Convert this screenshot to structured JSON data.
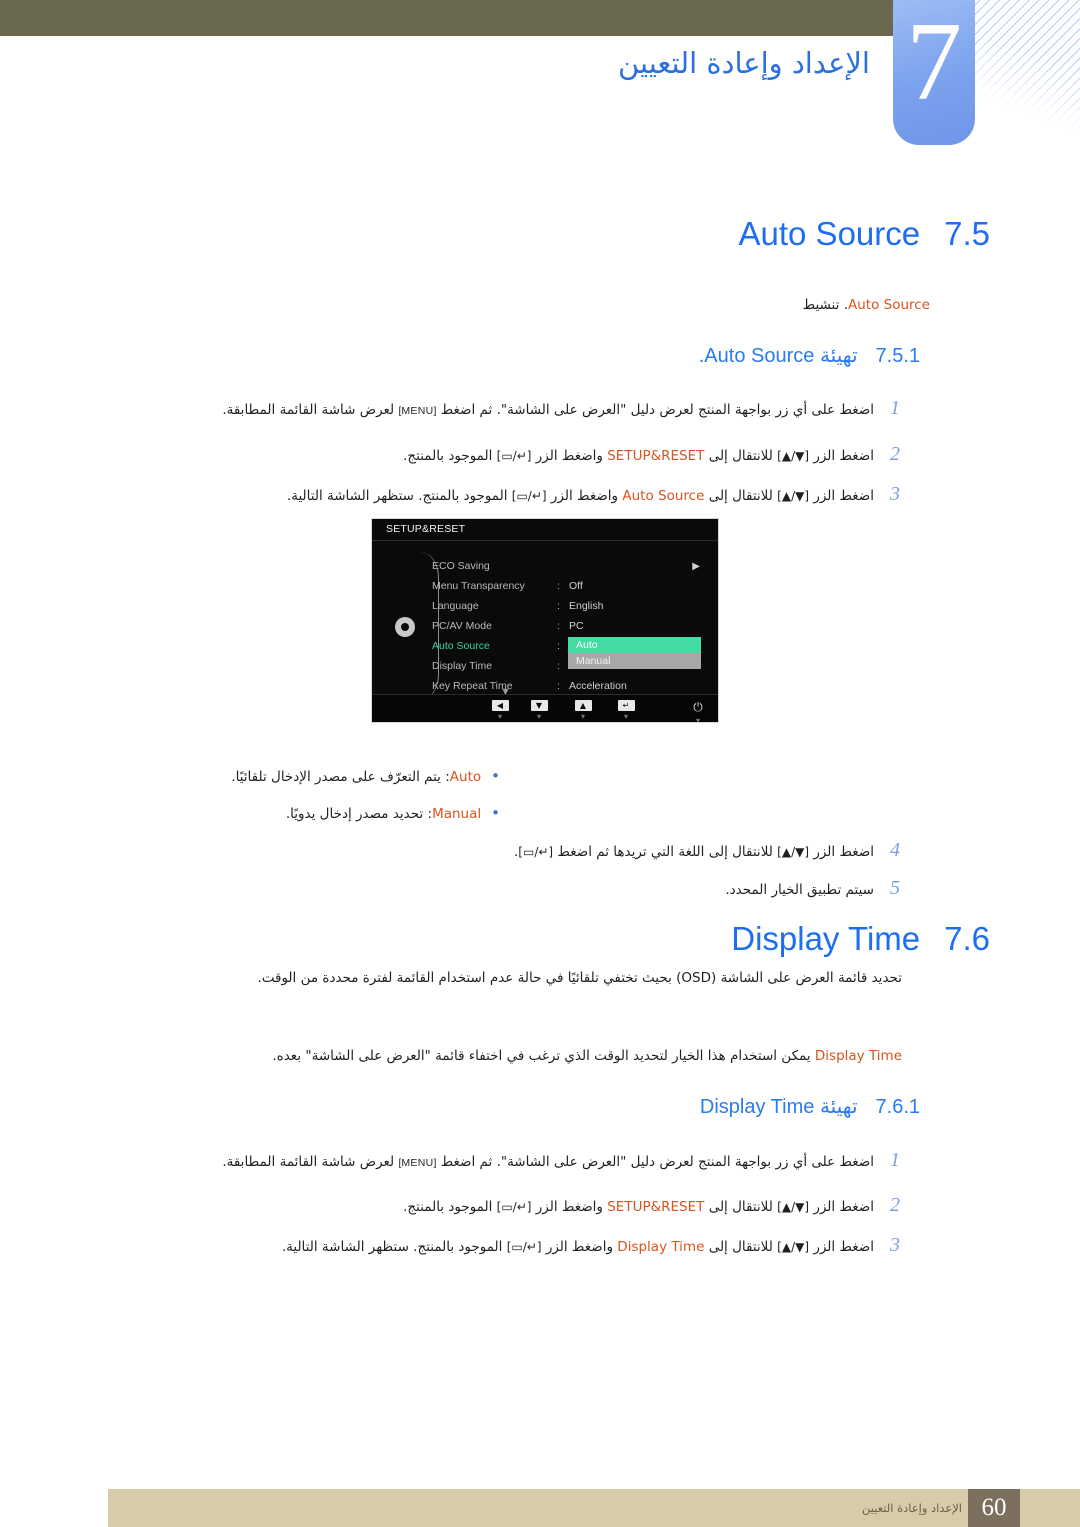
{
  "chapter": {
    "number": "7",
    "title": "الإعداد وإعادة التعيين"
  },
  "colors": {
    "heading_blue": "#1f6df0",
    "sub_blue": "#2a7bf2",
    "keyword_orange": "#d9541e",
    "step_number_blue": "#7c9fe0",
    "olive_bar": "#6b6850",
    "tab_blue": "#7ba2ee",
    "footer_band": "#d8cbaa",
    "footer_page_box": "#7d6f5d",
    "osd_background": "#0a0a0a",
    "osd_active_green": "#35d39b",
    "osd_highlight_green": "#46dba3",
    "osd_popup_gray": "#a8a8a8"
  },
  "sections": [
    {
      "number": "7.5",
      "title": "Auto Source",
      "intro": {
        "prefix": "تنشيط",
        "keyword": "Auto Source",
        "suffix": "."
      },
      "sub": {
        "number": "7.5.1",
        "prefix": "تهيئة",
        "keyword": "Auto Source",
        "suffix": "."
      },
      "steps": [
        {
          "num": "1",
          "a": "اضغط على أي زر بواجهة المنتج لعرض دليل \"العرض على الشاشة\". ثم اضغط",
          "key": "[MENU]",
          "b": "لعرض شاشة القائمة المطابقة."
        },
        {
          "num": "2",
          "a": "اضغط الزر",
          "key1": "[▲/▼]",
          "b": "للانتقال إلى",
          "kw": "SETUP&RESET",
          "c": "واضغط الزر",
          "key2": "[▭/↵]",
          "d": "الموجود بالمنتج."
        },
        {
          "num": "3",
          "a": "اضغط الزر",
          "key1": "[▲/▼]",
          "b": "للانتقال إلى",
          "kw": "Auto Source",
          "c": "واضغط الزر",
          "key2": "[▭/↵]",
          "d": "الموجود بالمنتج. ستظهر الشاشة التالية."
        }
      ],
      "bullets": [
        {
          "label": "Auto",
          "text": ": يتم التعرّف على مصدر الإدخال تلقائيًا."
        },
        {
          "label": "Manual",
          "text": ": تحديد مصدر إدخال يدويًا."
        }
      ],
      "steps_after": [
        {
          "num": "4",
          "a": "اضغط الزر",
          "key1": "[▲/▼]",
          "b": "للانتقال إلى اللغة التي تريدها ثم اضغط",
          "key2": "[▭/↵]",
          "d": "."
        },
        {
          "num": "5",
          "a": "سيتم تطبيق الخيار المحدد."
        }
      ]
    },
    {
      "number": "7.6",
      "title": "Display Time",
      "paragraphs": [
        "تحديد قائمة العرض على الشاشة (OSD) بحيث تختفي تلقائيًا في حالة عدم استخدام القائمة لفترة محددة من الوقت.",
        "يمكن استخدام هذا الخيار لتحديد الوقت الذي ترغب في اختفاء قائمة \"العرض على الشاشة\" بعده."
      ],
      "paragraph2_keyword": "Display Time",
      "sub": {
        "number": "7.6.1",
        "prefix": "تهيئة",
        "keyword": "Display Time",
        "suffix": ""
      },
      "steps": [
        {
          "num": "1",
          "a": "اضغط على أي زر بواجهة المنتج لعرض دليل \"العرض على الشاشة\". ثم اضغط",
          "key": "[MENU]",
          "b": "لعرض شاشة القائمة المطابقة."
        },
        {
          "num": "2",
          "a": "اضغط الزر",
          "key1": "[▲/▼]",
          "b": "للانتقال إلى",
          "kw": "SETUP&RESET",
          "c": "واضغط الزر",
          "key2": "[▭/↵]",
          "d": "الموجود بالمنتج."
        },
        {
          "num": "3",
          "a": "اضغط الزر",
          "key1": "[▲/▼]",
          "b": "للانتقال إلى",
          "kw": "Display Time",
          "c": "واضغط الزر",
          "key2": "[▭/↵]",
          "d": "الموجود بالمنتج. ستظهر الشاشة التالية."
        }
      ]
    }
  ],
  "osd": {
    "title": "SETUP&RESET",
    "items": [
      {
        "name": "ECO Saving",
        "value": "",
        "arrow": "▶",
        "active": false,
        "has_colon": false
      },
      {
        "name": "Menu Transparency",
        "value": "Off",
        "active": false,
        "has_colon": true
      },
      {
        "name": "Language",
        "value": "English",
        "active": false,
        "has_colon": true
      },
      {
        "name": "PC/AV Mode",
        "value": "PC",
        "active": false,
        "has_colon": true
      },
      {
        "name": "Auto Source",
        "value": "",
        "active": true,
        "has_colon": true
      },
      {
        "name": "Display Time",
        "value": "",
        "active": false,
        "has_colon": true
      },
      {
        "name": "Key Repeat Time",
        "value": "Acceleration",
        "active": false,
        "has_colon": true
      }
    ],
    "popup": {
      "options": [
        {
          "label": "Auto",
          "selected": true
        },
        {
          "label": "Manual",
          "selected": false
        }
      ]
    },
    "scroll_hint": "▼",
    "keys": [
      {
        "glyph": "◀",
        "tick": "▾"
      },
      {
        "glyph": "▼",
        "tick": "▾"
      },
      {
        "glyph": "▲",
        "tick": "▾"
      },
      {
        "glyph": "↵",
        "tick": "▾"
      }
    ],
    "power_glyph": "⏻",
    "power_tick": "▾"
  },
  "footer": {
    "page": "60",
    "text": "الإعداد وإعادة التعيين"
  }
}
